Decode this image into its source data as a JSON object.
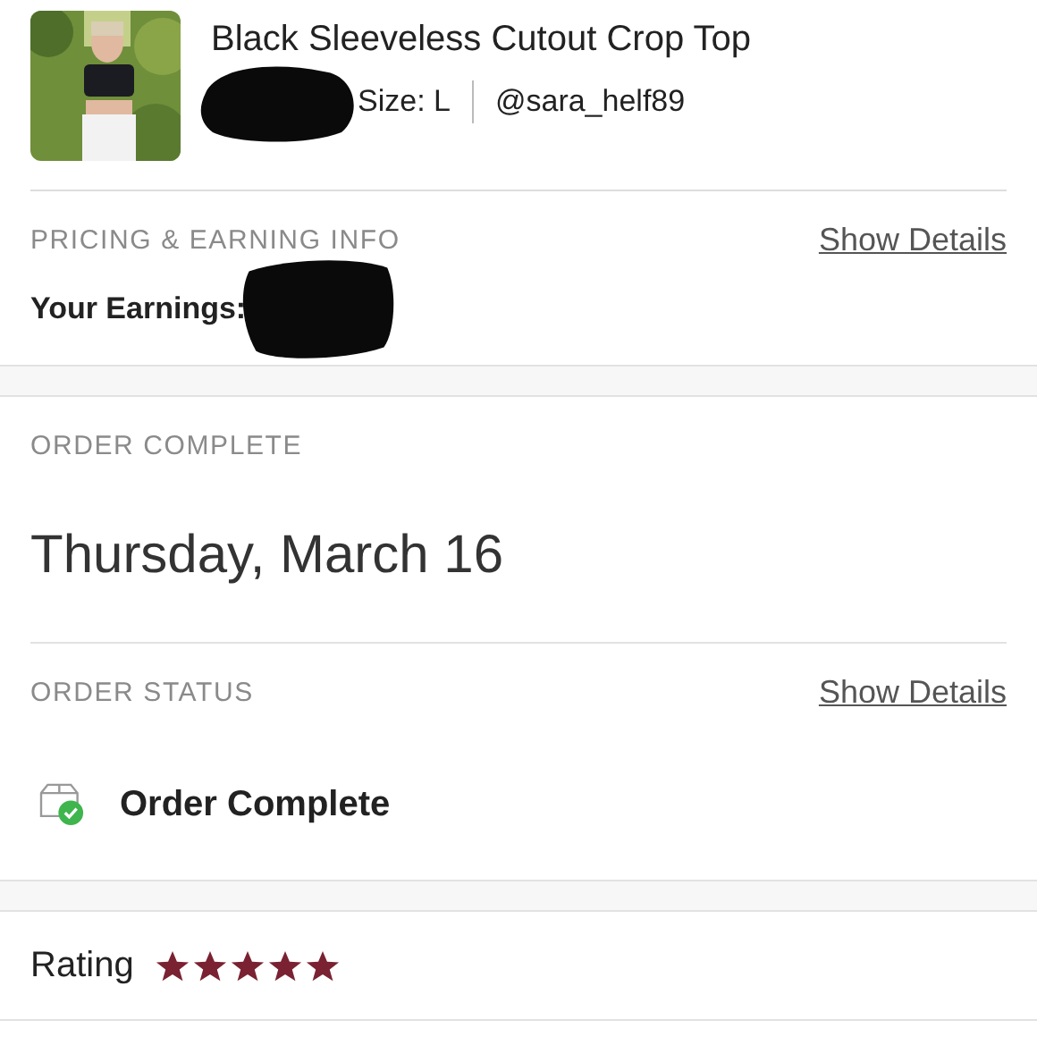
{
  "item": {
    "kind": "picture",
    "title": "Black Sleeveless Cutout Crop Top",
    "size": "Size: L",
    "seller": "@sara_helf89"
  },
  "pricing": {
    "heading": "PRICING & EARNING INFO",
    "link": "Show Details",
    "earnings_label": "Your Earnings:"
  },
  "order": {
    "heading": "ORDER COMPLETE",
    "date": "Thursday, March 16"
  },
  "status": {
    "heading": "ORDER STATUS",
    "link": "Show Details",
    "label": "Order Complete"
  },
  "rating": {
    "label": "Rating",
    "stars": 5
  }
}
